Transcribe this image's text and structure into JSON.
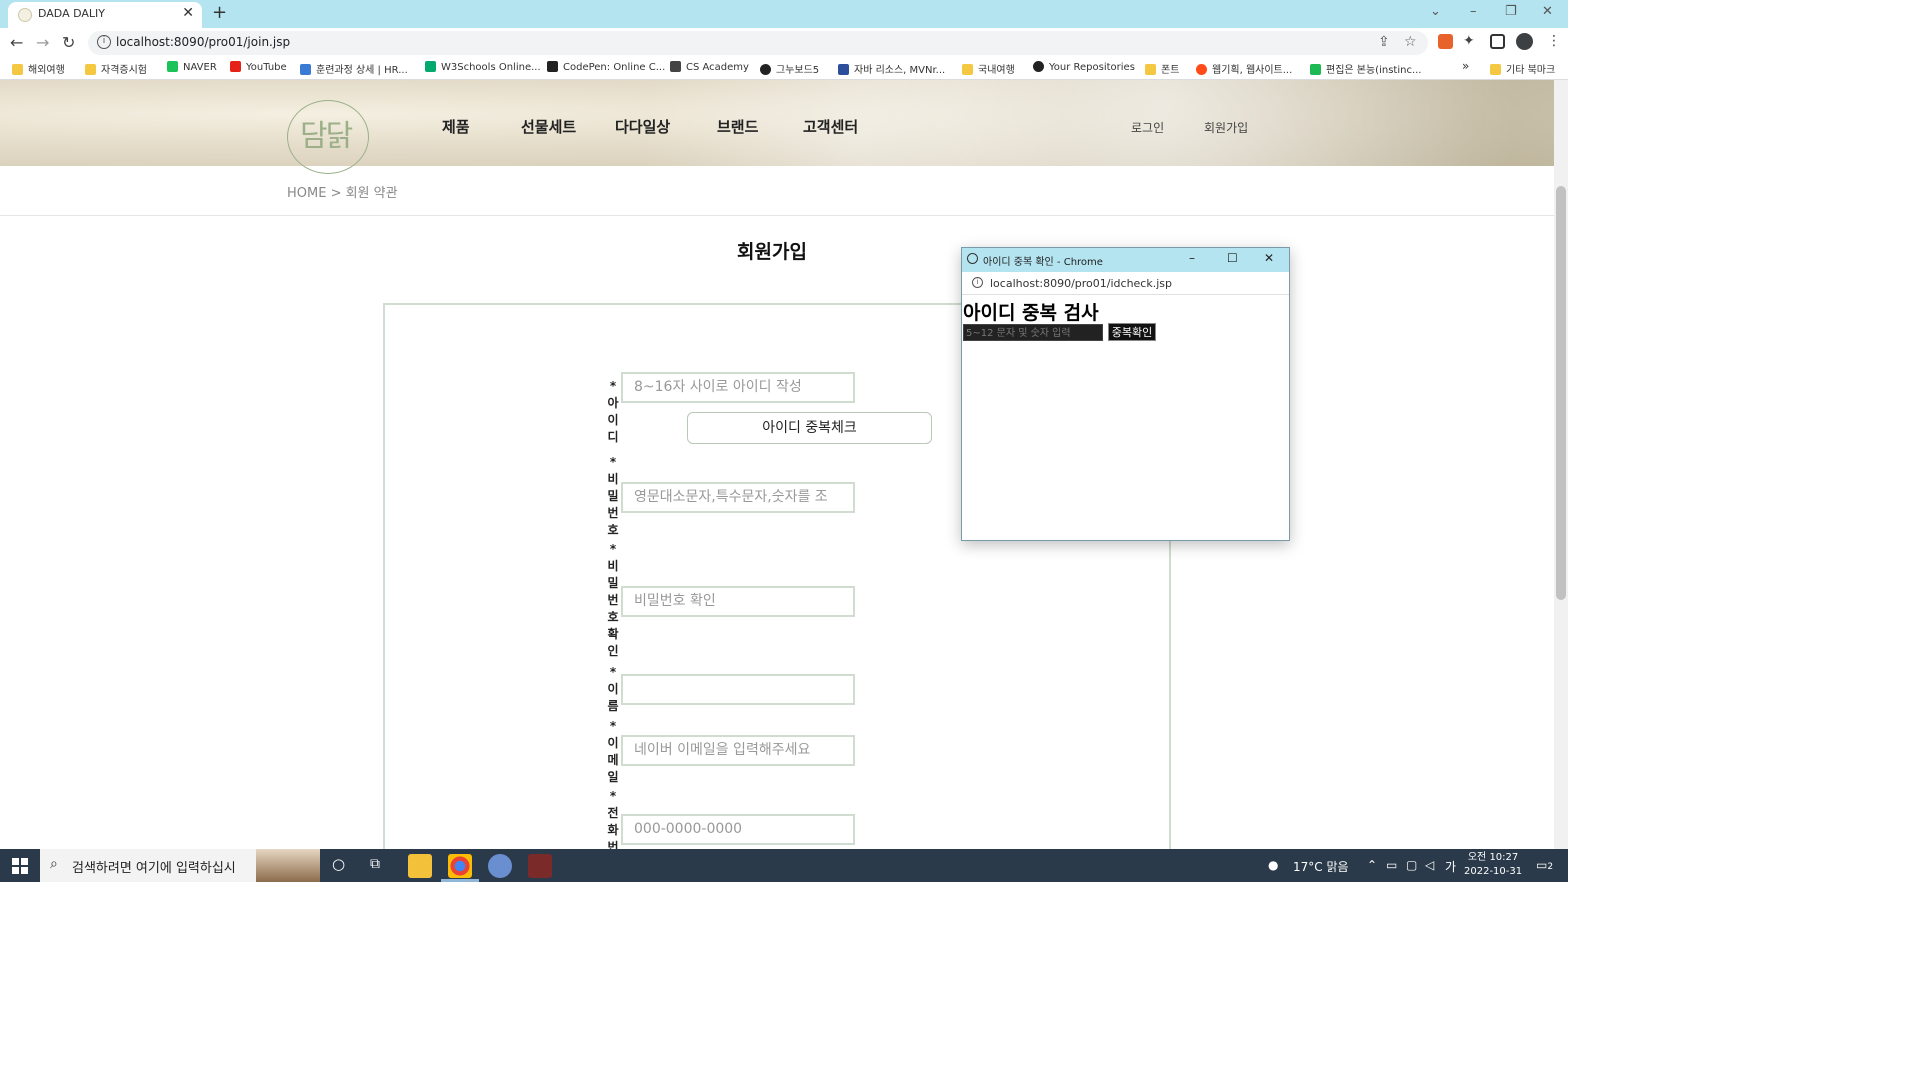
{
  "browser": {
    "tab_title": "DADA DALIY",
    "tab_close": "✕",
    "new_tab": "+",
    "url": "localhost:8090/pro01/join.jsp",
    "window_controls": {
      "chevron": "⌄",
      "minimize": "–",
      "restore": "❐",
      "close": "✕"
    }
  },
  "bookmarks": [
    {
      "label": "해외여행",
      "icon": "folder-icon"
    },
    {
      "label": "자격증시험",
      "icon": "folder-icon"
    },
    {
      "label": "NAVER",
      "icon": "naver-icon"
    },
    {
      "label": "YouTube",
      "icon": "youtube-icon"
    },
    {
      "label": "훈련과정 상세 | HR...",
      "icon": "hrd-icon"
    },
    {
      "label": "W3Schools Online...",
      "icon": "w3schools-icon"
    },
    {
      "label": "CodePen: Online C...",
      "icon": "codepen-icon"
    },
    {
      "label": "CS Academy",
      "icon": "cs-academy-icon"
    },
    {
      "label": "그누보드5",
      "icon": "gnuboard-icon"
    },
    {
      "label": "자바 리소스, MVNr...",
      "icon": "mvn-icon"
    },
    {
      "label": "국내여행",
      "icon": "folder-icon"
    },
    {
      "label": "Your Repositories",
      "icon": "github-icon"
    },
    {
      "label": "폰트",
      "icon": "folder-icon"
    },
    {
      "label": "웹기획, 웹사이트...",
      "icon": "opera-icon"
    },
    {
      "label": "편집은 본능(instinc...",
      "icon": "green-icon"
    }
  ],
  "bookmarks_more": "»",
  "bookmarks_other": "기타 북마크",
  "site": {
    "logo_text": "담닭",
    "nav": [
      "제품",
      "선물세트",
      "다다일상",
      "브랜드",
      "고객센터"
    ],
    "util": {
      "login": "로그인",
      "join": "회원가입"
    },
    "breadcrumb": "HOME > 회원 약관",
    "title": "회원가입"
  },
  "form": {
    "id_label": "*아이디",
    "id_placeholder": "8~16자 사이로 아이디 작성",
    "dup_check_button": "아이디 중복체크",
    "pw_label": "*비밀번호",
    "pw_placeholder": "영문대소문자,특수문자,숫자를 조",
    "pw_confirm_label": "*비밀번호확인",
    "pw_confirm_placeholder": "비밀번호 확인",
    "name_label": "*이름",
    "name_value": "",
    "email_label": "*이메일",
    "email_placeholder": "네이버 이메일을 입력해주세요",
    "phone_label": "*전화번",
    "phone_placeholder": "000-0000-0000"
  },
  "popup": {
    "window_title": "아이디 중복 확인 - Chrome",
    "url": "localhost:8090/pro01/idcheck.jsp",
    "heading": "아이디 중복 검사",
    "input_placeholder": "5~12 문자 및 숫자 입력",
    "button": "중복확인",
    "controls": {
      "minimize": "–",
      "maximize": "☐",
      "close": "✕"
    }
  },
  "taskbar": {
    "search_placeholder": "검색하려면 여기에 입력하십시",
    "weather": "17°C 맑음",
    "ime": "가",
    "time": "오전 10:27",
    "date": "2022-10-31",
    "notifications": "2"
  }
}
